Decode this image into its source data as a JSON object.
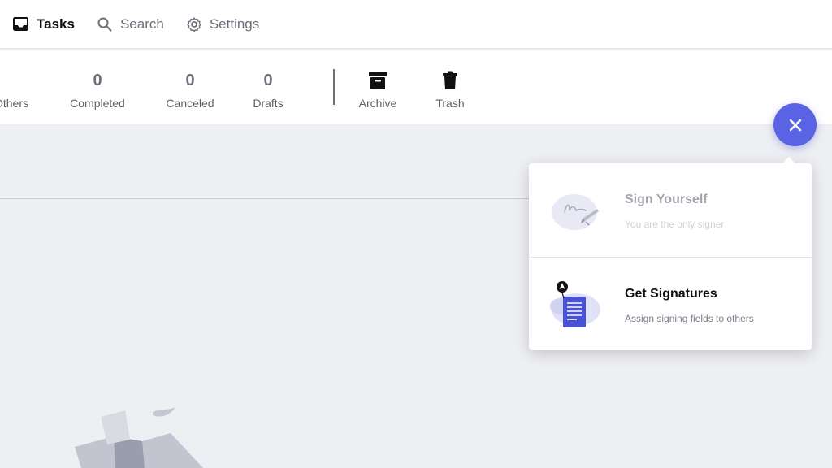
{
  "nav": {
    "tabs": [
      {
        "label": "Tasks",
        "icon": "inbox-icon",
        "active": true
      },
      {
        "label": "Search",
        "icon": "search-icon"
      },
      {
        "label": "Settings",
        "icon": "gear-icon"
      }
    ]
  },
  "status": {
    "others_label": "Others",
    "completed": {
      "count": "0",
      "label": "Completed"
    },
    "canceled": {
      "count": "0",
      "label": "Canceled"
    },
    "drafts": {
      "count": "0",
      "label": "Drafts"
    },
    "archive": {
      "label": "Archive",
      "icon": "archive-icon"
    },
    "trash": {
      "label": "Trash",
      "icon": "trash-icon"
    }
  },
  "popover": {
    "sign_yourself": {
      "title": "Sign Yourself",
      "desc": "You are the only signer",
      "icon": "signature-icon"
    },
    "get_signatures": {
      "title": "Get Signatures",
      "desc": "Assign signing fields to others",
      "icon": "document-send-icon"
    }
  },
  "colors": {
    "accent": "#5a63e3",
    "background": "#eeeff3"
  }
}
